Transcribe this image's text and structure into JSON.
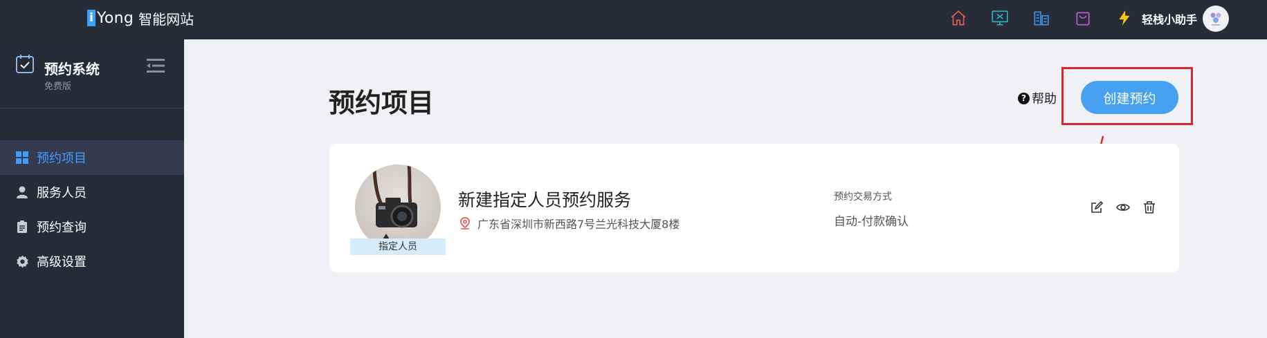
{
  "header": {
    "logo_mark": "i",
    "brand": "Yong",
    "site_name": "智能网站",
    "icons": [
      "home-icon",
      "monitor-icon",
      "building-icon",
      "shopping-bag-icon",
      "lightning-icon"
    ],
    "user_name": "轻栈小助手"
  },
  "sidebar": {
    "system_title": "预约系统",
    "edition": "免费版",
    "items": [
      {
        "label": "预约项目",
        "icon": "grid-icon",
        "active": true
      },
      {
        "label": "服务人员",
        "icon": "person-icon",
        "active": false
      },
      {
        "label": "预约查询",
        "icon": "clipboard-icon",
        "active": false
      },
      {
        "label": "高级设置",
        "icon": "gear-icon",
        "active": false
      }
    ]
  },
  "main": {
    "title": "预约项目",
    "help_label": "帮助",
    "create_button": "创建预约"
  },
  "card": {
    "tag": "指定人员",
    "name": "新建指定人员预约服务",
    "address": "广东省深圳市新西路7号兰光科技大厦8楼",
    "trade_label": "预约交易方式",
    "trade_value": "自动-付款确认",
    "actions": [
      "edit-icon",
      "eye-icon",
      "trash-icon"
    ]
  },
  "colors": {
    "topbar": "#282c37",
    "sidebar": "#262b38",
    "accent": "#409eff",
    "button": "#46a2f0",
    "highlight": "#d9262c"
  }
}
